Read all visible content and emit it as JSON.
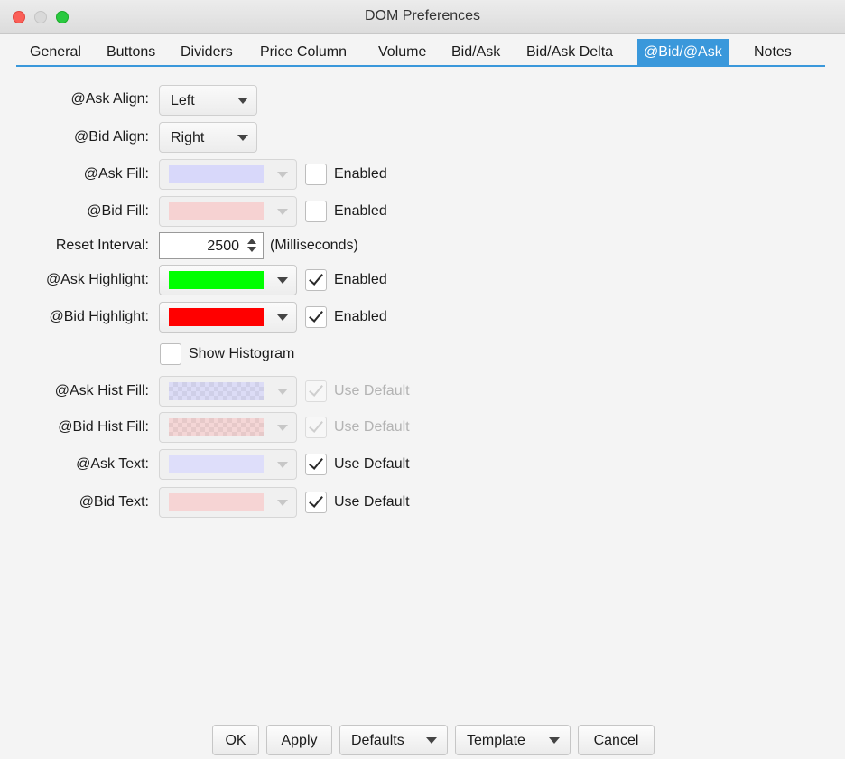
{
  "window": {
    "title": "DOM Preferences",
    "accent_color": "#3a98db"
  },
  "tabs": [
    {
      "label": "General"
    },
    {
      "label": "Buttons"
    },
    {
      "label": "Dividers"
    },
    {
      "label": "Price Column"
    },
    {
      "label": "Volume"
    },
    {
      "label": "Bid/Ask"
    },
    {
      "label": "Bid/Ask Delta"
    },
    {
      "label": "@Bid/@Ask",
      "active": true
    },
    {
      "label": "Notes"
    }
  ],
  "form": {
    "ask_align": {
      "label": "@Ask Align:",
      "value": "Left"
    },
    "bid_align": {
      "label": "@Bid Align:",
      "value": "Right"
    },
    "ask_fill": {
      "label": "@Ask Fill:",
      "color": "#d8d8fa",
      "checkbox_label": "Enabled",
      "checked": false
    },
    "bid_fill": {
      "label": "@Bid Fill:",
      "color": "#f6d2d2",
      "checkbox_label": "Enabled",
      "checked": false
    },
    "reset_interval": {
      "label": "Reset Interval:",
      "value": "2500",
      "unit": "(Milliseconds)"
    },
    "ask_highlight": {
      "label": "@Ask Highlight:",
      "color": "#00ff00",
      "checkbox_label": "Enabled",
      "checked": true
    },
    "bid_highlight": {
      "label": "@Bid Highlight:",
      "color": "#ff0000",
      "checkbox_label": "Enabled",
      "checked": true
    },
    "show_histogram": {
      "label": "Show Histogram",
      "checked": false
    },
    "ask_hist_fill": {
      "label": "@Ask Hist Fill:",
      "color": "#dcdcf6",
      "checkbox_label": "Use Default",
      "checked": true,
      "disabled": true
    },
    "bid_hist_fill": {
      "label": "@Bid Hist Fill:",
      "color": "#f4d6d6",
      "checkbox_label": "Use Default",
      "checked": true,
      "disabled": true
    },
    "ask_text": {
      "label": "@Ask Text:",
      "color": "#dedefa",
      "checkbox_label": "Use Default",
      "checked": true
    },
    "bid_text": {
      "label": "@Bid Text:",
      "color": "#f6d4d4",
      "checkbox_label": "Use Default",
      "checked": true
    }
  },
  "buttons": {
    "ok": "OK",
    "apply": "Apply",
    "defaults": "Defaults",
    "template": "Template",
    "cancel": "Cancel"
  }
}
